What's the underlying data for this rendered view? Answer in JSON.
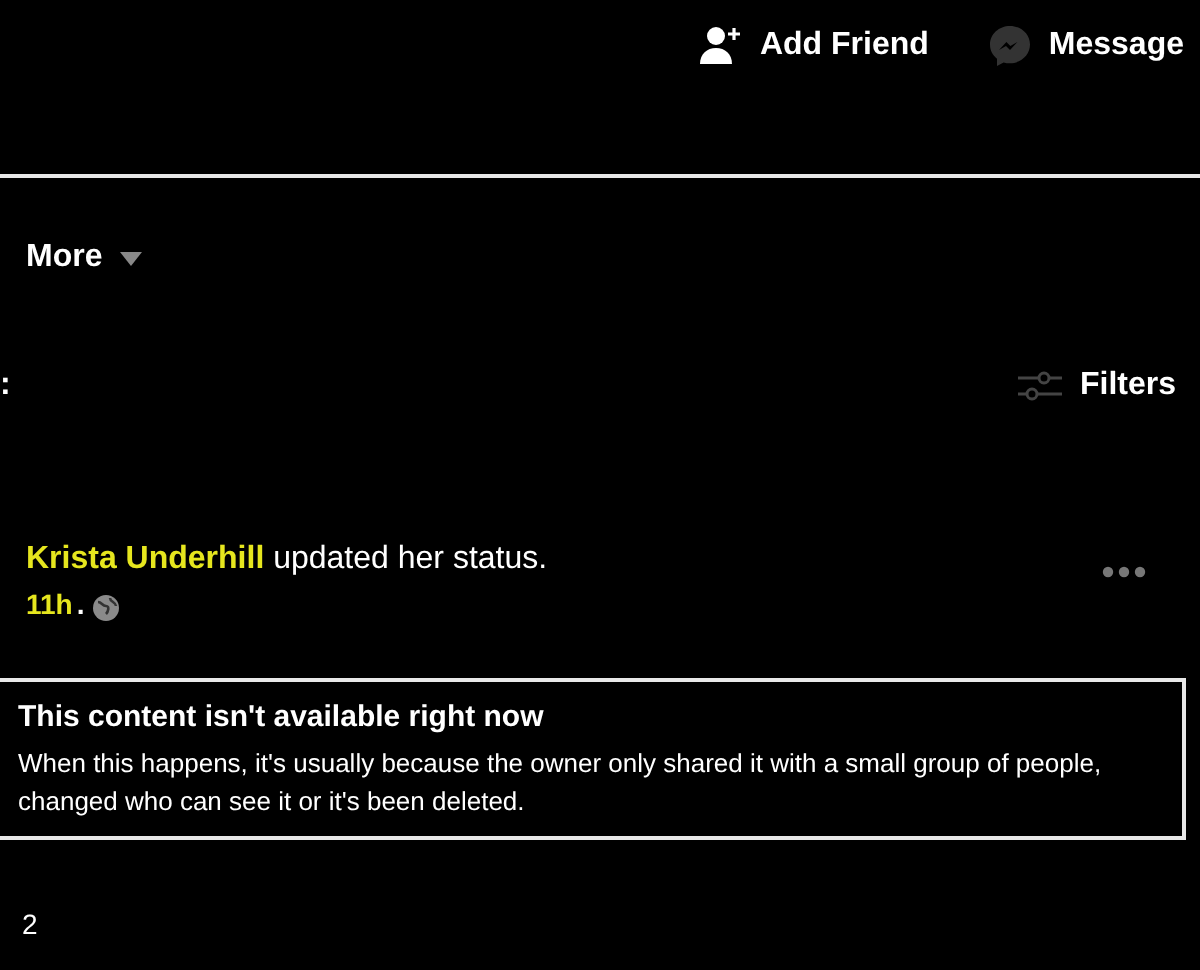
{
  "header": {
    "buttons": [
      {
        "kind": "add-friend",
        "label": "Add Friend"
      },
      {
        "kind": "message",
        "label": "Message"
      }
    ]
  },
  "tabs": {
    "more_label": "More"
  },
  "section": {
    "heading_tail": ":",
    "filters_label": "Filters"
  },
  "post": {
    "author": "Krista Underhill",
    "action": "updated her status.",
    "time": "11h",
    "separator": ".",
    "notice": {
      "title": "This content isn't available right now",
      "body": "When this happens, it's usually because the owner only shared it with a small group of people, changed who can see it or it's been deleted."
    },
    "reaction_count": "2"
  }
}
